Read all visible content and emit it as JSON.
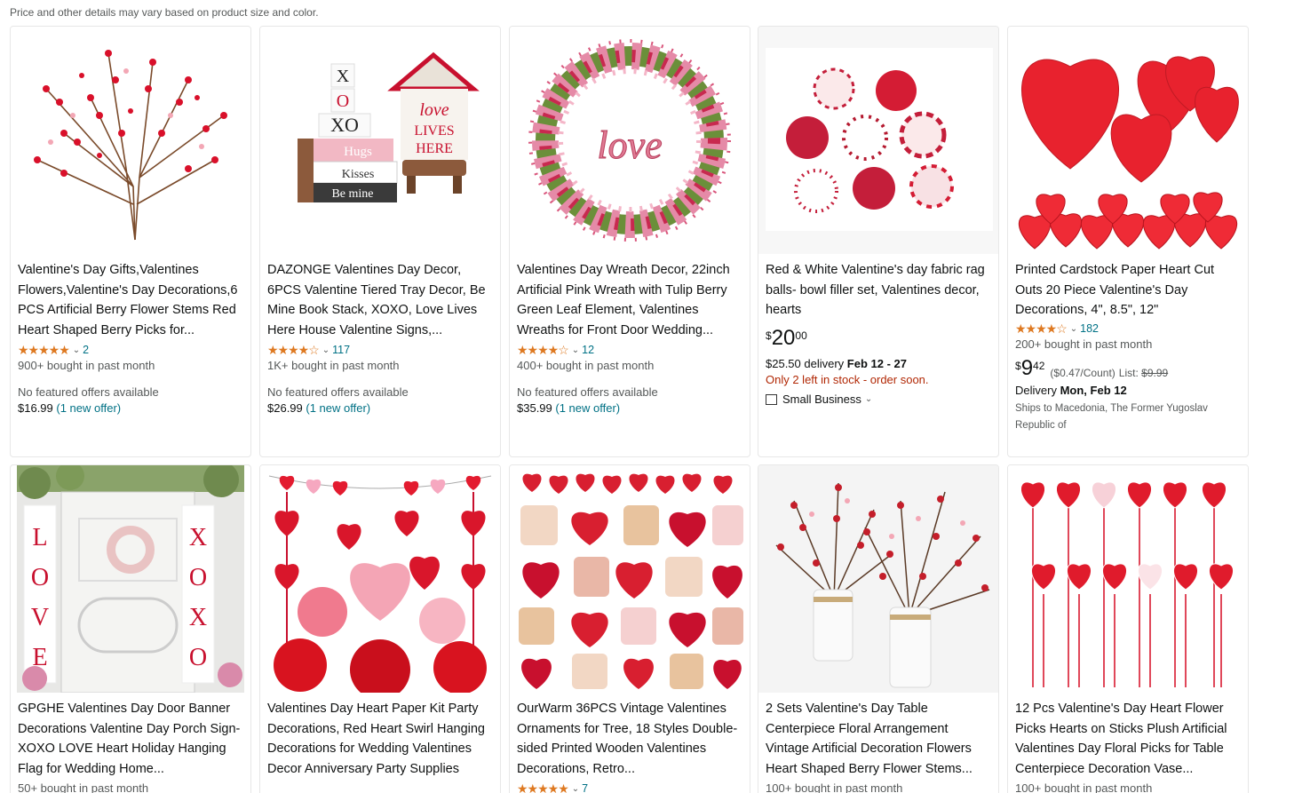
{
  "disclaimer": "Price and other details may vary based on product size and color.",
  "products": [
    {
      "title": "Valentine's Day Gifts,Valentines Flowers,Valentine's Day Decorations,6 PCS Artificial Berry Flower Stems Red Heart Shaped Berry Picks for...",
      "stars": "★★★★★",
      "rating_count": "2",
      "bought": "900+ bought in past month",
      "no_offers": "No featured offers available",
      "offer_price": "$16.99",
      "offer_link": "(1 new offer)",
      "image": "berry-stems"
    },
    {
      "title": "DAZONGE Valentines Day Decor, 6PCS Valentine Tiered Tray Decor, Be Mine Book Stack, XOXO, Love Lives Here House Valentine Signs,...",
      "stars": "★★★★☆",
      "rating_count": "117",
      "bought": "1K+ bought in past month",
      "no_offers": "No featured offers available",
      "offer_price": "$26.99",
      "offer_link": "(1 new offer)",
      "image": "tray-decor",
      "img_text": {
        "x": "X",
        "o": "O",
        "xo": "XO",
        "hugs": "Hugs",
        "kisses": "Kisses",
        "bemine": "Be mine",
        "love": "love",
        "lives": "LIVES",
        "here": "HERE"
      }
    },
    {
      "title": "Valentines Day Wreath Decor, 22inch Artificial Pink Wreath with Tulip Berry Green Leaf Element, Valentines Wreaths for Front Door Wedding...",
      "stars": "★★★★☆",
      "rating_count": "12",
      "bought": "400+ bought in past month",
      "no_offers": "No featured offers available",
      "offer_price": "$35.99",
      "offer_link": "(1 new offer)",
      "image": "pink-wreath",
      "img_text": {
        "love": "love"
      }
    },
    {
      "title": "Red & White Valentine's day fabric rag balls- bowl filler set, Valentines decor, hearts",
      "price_symbol": "$",
      "price_whole": "20",
      "price_fraction": "00",
      "delivery_cost": "$25.50 delivery",
      "delivery_date": "Feb 12 - 27",
      "stock": "Only 2 left in stock - order soon.",
      "badge": "Small Business",
      "image": "rag-balls"
    },
    {
      "title": "Printed Cardstock Paper Heart Cut Outs 20 Piece Valentine's Day Decorations, 4\", 8.5\", 12\"",
      "stars": "★★★★☆",
      "rating_count": "182",
      "bought": "200+ bought in past month",
      "price_symbol": "$",
      "price_whole": "9",
      "price_fraction": "42",
      "unit_price": "($0.47/Count)",
      "list_label": "List:",
      "list_price": "$9.99",
      "delivery_label": "Delivery",
      "delivery_date": "Mon, Feb 12",
      "ships": "Ships to Macedonia, The Former Yugoslav Republic of",
      "image": "paper-hearts"
    },
    {
      "title": "GPGHE Valentines Day Door Banner Decorations Valentine Day Porch Sign- XOXO LOVE Heart Holiday Hanging Flag for Wedding Home...",
      "bought": "50+ bought in past month",
      "image": "door-banner",
      "img_text": {
        "l": "L",
        "o": "O",
        "v": "V",
        "e": "E",
        "x": "X"
      }
    },
    {
      "title": "Valentines Day Heart Paper Kit Party Decorations, Red Heart Swirl Hanging Decorations for Wedding Valentines Decor Anniversary Party Supplies",
      "image": "heart-paper-kit"
    },
    {
      "title": "OurWarm 36PCS Vintage Valentines Ornaments for Tree, 18 Styles Double-sided Printed Wooden Valentines Decorations, Retro...",
      "stars": "★★★★★",
      "rating_count": "7",
      "image": "vintage-ornaments"
    },
    {
      "title": "2 Sets Valentine's Day Table Centerpiece Floral Arrangement Vintage Artificial Decoration Flowers Heart Shaped Berry Flower Stems...",
      "bought": "100+ bought in past month",
      "image": "table-centerpiece"
    },
    {
      "title": "12 Pcs Valentine's Day Heart Flower Picks Hearts on Sticks Plush Artificial Valentines Day Floral Picks for Table Centerpiece Decoration Vase...",
      "bought": "100+ bought in past month",
      "image": "heart-picks"
    }
  ],
  "colors": {
    "star": "#de7921",
    "link": "#007185",
    "stock_red": "#b12704",
    "muted": "#565959"
  }
}
